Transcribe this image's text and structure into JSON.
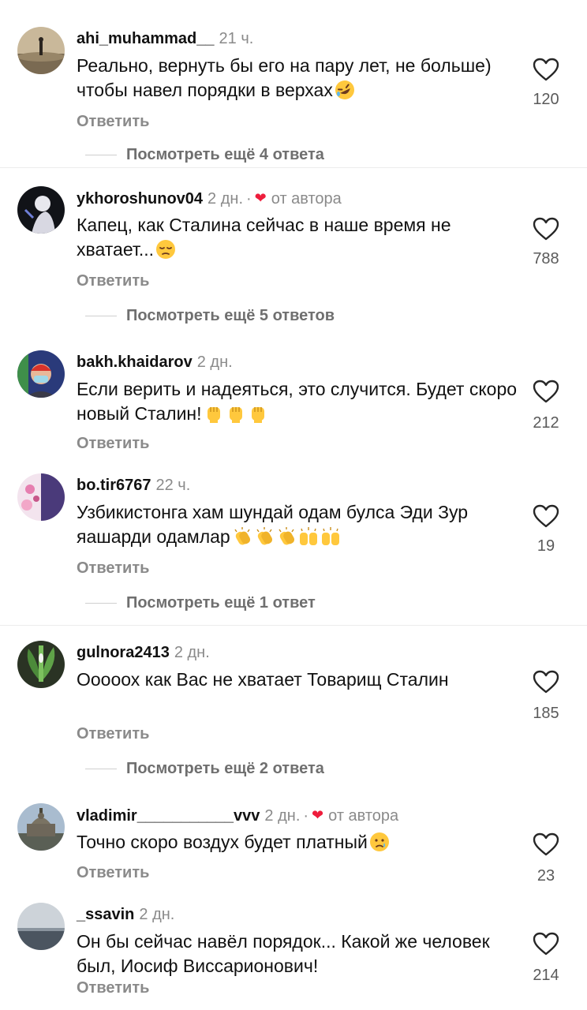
{
  "comments": [
    {
      "username": "ahi_muhammad__",
      "time": "21 ч.",
      "text": "Реально, вернуть бы его на пару лет, не больше) чтобы навел порядки в верхах",
      "emojis": [
        "rofl-emoji"
      ],
      "reply_label": "Ответить",
      "like_count": "120",
      "more_replies": "Посмотреть ещё 4 ответа"
    },
    {
      "username": "ykhoroshunov04",
      "time": "2 дн.",
      "author_label": "от автора",
      "text": "Капец, как Сталина сейчас в наше время не хватает...",
      "emojis": [
        "pensive-face-emoji"
      ],
      "reply_label": "Ответить",
      "like_count": "788",
      "more_replies": "Посмотреть ещё 5 ответов"
    },
    {
      "username": "bakh.khaidarov",
      "time": "2 дн.",
      "text": "Если верить и надеяться, это случится. Будет  скоро новый Сталин!",
      "emojis": [
        "raised-fist-emoji",
        "raised-fist-emoji",
        "raised-fist-emoji"
      ],
      "reply_label": "Ответить",
      "like_count": "212"
    },
    {
      "username": "bo.tir6767",
      "time": "22 ч.",
      "text": "Узбикистонга хам шундай одам булса Эди Зур яашарди одамлар",
      "emojis": [
        "clapping-hands-emoji",
        "clapping-hands-emoji",
        "clapping-hands-emoji",
        "raising-hands-emoji",
        "raising-hands-emoji"
      ],
      "reply_label": "Ответить",
      "like_count": "19",
      "more_replies": "Посмотреть ещё 1 ответ"
    },
    {
      "username": "gulnora2413",
      "time": "2 дн.",
      "text": "Оооoох как Вас не хватает Товарищ Сталин",
      "emojis": [],
      "reply_label": "Ответить",
      "like_count": "185",
      "more_replies": "Посмотреть ещё 2 ответа"
    },
    {
      "username": "vladimir___________vvv",
      "time": "2 дн.",
      "author_label": "от автора",
      "text": "Точно скоро воздух будет платный",
      "emojis": [
        "crying-face-emoji"
      ],
      "reply_label": "Ответить",
      "like_count": "23"
    },
    {
      "username": "_ssavin",
      "time": "2 дн.",
      "text": "Он бы сейчас навёл порядок... Какой же человек был, Иосиф Виссарионович!",
      "emojis": [],
      "reply_label": "Ответить",
      "like_count": "214"
    }
  ],
  "colors": {
    "author_heart": "#ee1d3c",
    "muted_text": "#8a8a8a",
    "emoji_yellow": "#ffc83d"
  }
}
